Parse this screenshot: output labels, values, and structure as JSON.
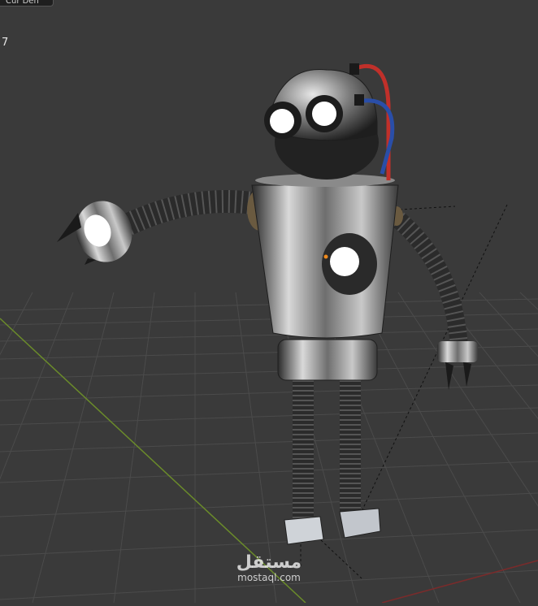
{
  "viewport": {
    "header_chip_text": "Cur Den",
    "frame_number": "7",
    "background_color": "#3a3a3a",
    "grid_color": "#4a4a4a",
    "x_axis_color": "#7a2b2b",
    "y_axis_color": "#6b8c2a"
  },
  "watermark": {
    "arabic_text": "مستقل",
    "latin_text": "mostaql.com"
  },
  "scene": {
    "object": "robot-model",
    "hose_colors": [
      "#c0302a",
      "#2a4ea8"
    ]
  }
}
